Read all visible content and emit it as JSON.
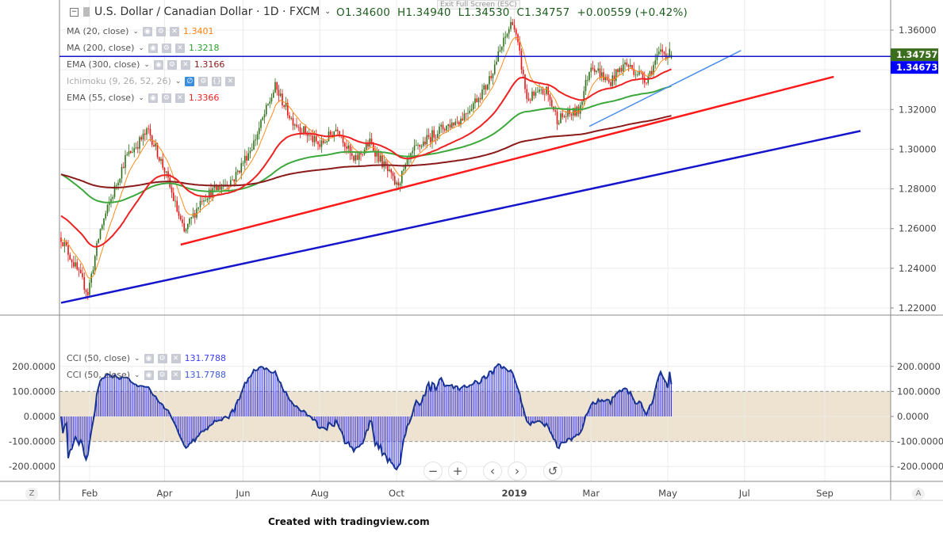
{
  "header": {
    "symbol": "U.S. Dollar / Canadian Dollar · 1D · FXCM",
    "open": "O1.34600",
    "high": "H1.34940",
    "low": "L1.34530",
    "close": "C1.34757",
    "change": "+0.00559 (+0.42%)",
    "tooltip": "Exit Full Screen (ESC)"
  },
  "indicators": [
    {
      "label": "MA (20, close)",
      "value": "1.3401",
      "color": "#ff7f0e"
    },
    {
      "label": "MA (200, close)",
      "value": "1.3218",
      "color": "#2ca02c"
    },
    {
      "label": "EMA (300, close)",
      "value": "1.3166",
      "color": "#8b1a1a"
    },
    {
      "label": "Ichimoku (9, 26, 52, 26)",
      "value": "",
      "color": "#aaaaaa"
    },
    {
      "label": "EMA (55, close)",
      "value": "1.3366",
      "color": "#ee2222"
    }
  ],
  "cci_legend": [
    {
      "label": "CCI (50, close)",
      "value": "131.7788"
    },
    {
      "label": "CCI (50, close)",
      "value": "131.7788"
    }
  ],
  "price_labels": {
    "last": "1.34757",
    "line": "1.34673",
    "last_color": "#3a6e1c",
    "line_color": "#0000ff"
  },
  "nav": {
    "zoom_out": "−",
    "zoom_in": "+",
    "prev": "‹",
    "next": "›",
    "reset": "↺"
  },
  "corners": {
    "left": "Z",
    "right": "A"
  },
  "footer": "Created with tradingview.com",
  "chart_data": {
    "type": "candlestick",
    "title": "U.S. Dollar / Canadian Dollar · 1D · FXCM",
    "price_ticks": [
      "1.36000",
      "1.34000",
      "1.32000",
      "1.30000",
      "1.28000",
      "1.26000",
      "1.24000",
      "1.22000"
    ],
    "price_range": [
      1.2175,
      1.375
    ],
    "cci_ticks": [
      "200.0000",
      "100.0000",
      "0.0000",
      "-100.0000",
      "-200.0000"
    ],
    "cci_range": [
      -280,
      260
    ],
    "x_ticks": [
      {
        "label": "Feb",
        "date": "2018-02-01"
      },
      {
        "label": "Apr",
        "date": "2018-04-02"
      },
      {
        "label": "Jun",
        "date": "2018-06-01"
      },
      {
        "label": "Aug",
        "date": "2018-08-01"
      },
      {
        "label": "Oct",
        "date": "2018-10-01"
      },
      {
        "label": "2019",
        "date": "2019-01-01"
      },
      {
        "label": "Mar",
        "date": "2019-03-01"
      },
      {
        "label": "May",
        "date": "2019-05-01"
      },
      {
        "label": "Jul",
        "date": "2019-07-01"
      },
      {
        "label": "Sep",
        "date": "2019-09-02"
      }
    ],
    "close_anchors": [
      [
        "2018-01-10",
        1.2555
      ],
      [
        "2018-01-31",
        1.2276
      ],
      [
        "2018-02-09",
        1.2595
      ],
      [
        "2018-03-01",
        1.2954
      ],
      [
        "2018-03-20",
        1.3093
      ],
      [
        "2018-04-02",
        1.2894
      ],
      [
        "2018-04-17",
        1.2575
      ],
      [
        "2018-05-01",
        1.2755
      ],
      [
        "2018-05-25",
        1.2854
      ],
      [
        "2018-06-11",
        1.3034
      ],
      [
        "2018-06-27",
        1.3313
      ],
      [
        "2018-07-10",
        1.3153
      ],
      [
        "2018-08-01",
        1.3014
      ],
      [
        "2018-08-15",
        1.3113
      ],
      [
        "2018-08-28",
        1.2934
      ],
      [
        "2018-09-10",
        1.3034
      ],
      [
        "2018-10-01",
        1.2814
      ],
      [
        "2018-10-15",
        1.2994
      ],
      [
        "2018-11-01",
        1.3093
      ],
      [
        "2018-11-20",
        1.3153
      ],
      [
        "2018-12-10",
        1.3313
      ],
      [
        "2018-12-31",
        1.3652
      ],
      [
        "2019-01-04",
        1.3472
      ],
      [
        "2019-01-10",
        1.3253
      ],
      [
        "2019-01-25",
        1.3293
      ],
      [
        "2019-02-04",
        1.3153
      ],
      [
        "2019-02-20",
        1.3193
      ],
      [
        "2019-03-01",
        1.3432
      ],
      [
        "2019-03-15",
        1.3333
      ],
      [
        "2019-03-28",
        1.3432
      ],
      [
        "2019-04-15",
        1.3353
      ],
      [
        "2019-04-25",
        1.3492
      ],
      [
        "2019-05-03",
        1.34757
      ]
    ],
    "last_candle": {
      "open": 1.346,
      "high": 1.3494,
      "low": 1.3453,
      "close": 1.34757
    },
    "moving_averages": [
      {
        "name": "MA 20",
        "period": 10,
        "seed": 1.255,
        "color": "#ff8c1a"
      },
      {
        "name": "MA 200",
        "period": 120,
        "seed": 1.288,
        "color": "#3ca83c"
      },
      {
        "name": "EMA 300",
        "period": 300,
        "seed": 1.2875,
        "color": "#8b1a1a"
      },
      {
        "name": "EMA 55",
        "period": 45,
        "seed": 1.267,
        "color": "#ee2222"
      }
    ],
    "trendlines": [
      {
        "name": "lower-blue",
        "from": [
          "2018-01-10",
          1.2226
        ],
        "to": [
          "2019-09-30",
          1.3092
        ],
        "color": "#1515cc"
      },
      {
        "name": "red-support",
        "from": [
          "2018-04-13",
          1.2519
        ],
        "to": [
          "2019-09-09",
          1.3365
        ],
        "color": "#ff1a1a"
      },
      {
        "name": "light-blue",
        "from": [
          "2019-02-28",
          1.3115
        ],
        "to": [
          "2019-06-27",
          1.3497
        ],
        "color": "#4d8fe8"
      }
    ],
    "horizontal_line": {
      "price": 1.34673,
      "color": "#1515cc"
    },
    "cci_period": 50,
    "cci_band": [
      -100,
      100
    ]
  }
}
